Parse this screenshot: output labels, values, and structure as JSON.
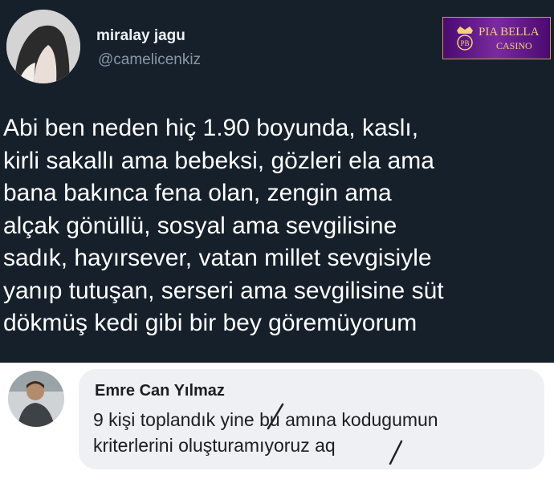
{
  "tweet": {
    "display_name": "miralay jagu",
    "handle": "@camelicenkiz",
    "text_lines": [
      "Abi ben neden hiç 1.90 boyunda, kaslı,",
      "kirli sakallı ama bebeksi, gözleri ela ama",
      "bana bakınca fena olan, zengin ama",
      "alçak gönüllü, sosyal ama sevgilisine",
      "sadık, hayırsever, vatan millet sevgisiyle",
      "yanıp tutuşan, serseri ama sevgilisine süt",
      "dökmüş kedi gibi bir bey göremüyorum"
    ]
  },
  "watermark": {
    "line1": "PIA BELLA",
    "line2": "CASINO",
    "monogram": "PB"
  },
  "reply": {
    "author": "Emre Can Yılmaz",
    "text_lines": [
      "9 kişi toplandık yine bu amına kodugumun",
      "kriterlerini oluşturamıyoruz aq"
    ]
  },
  "colors": {
    "tweet_background": "#16202b",
    "reply_bubble": "#eef0f3",
    "watermark_purple": "#5a1580",
    "watermark_gold": "#f3d27a"
  }
}
